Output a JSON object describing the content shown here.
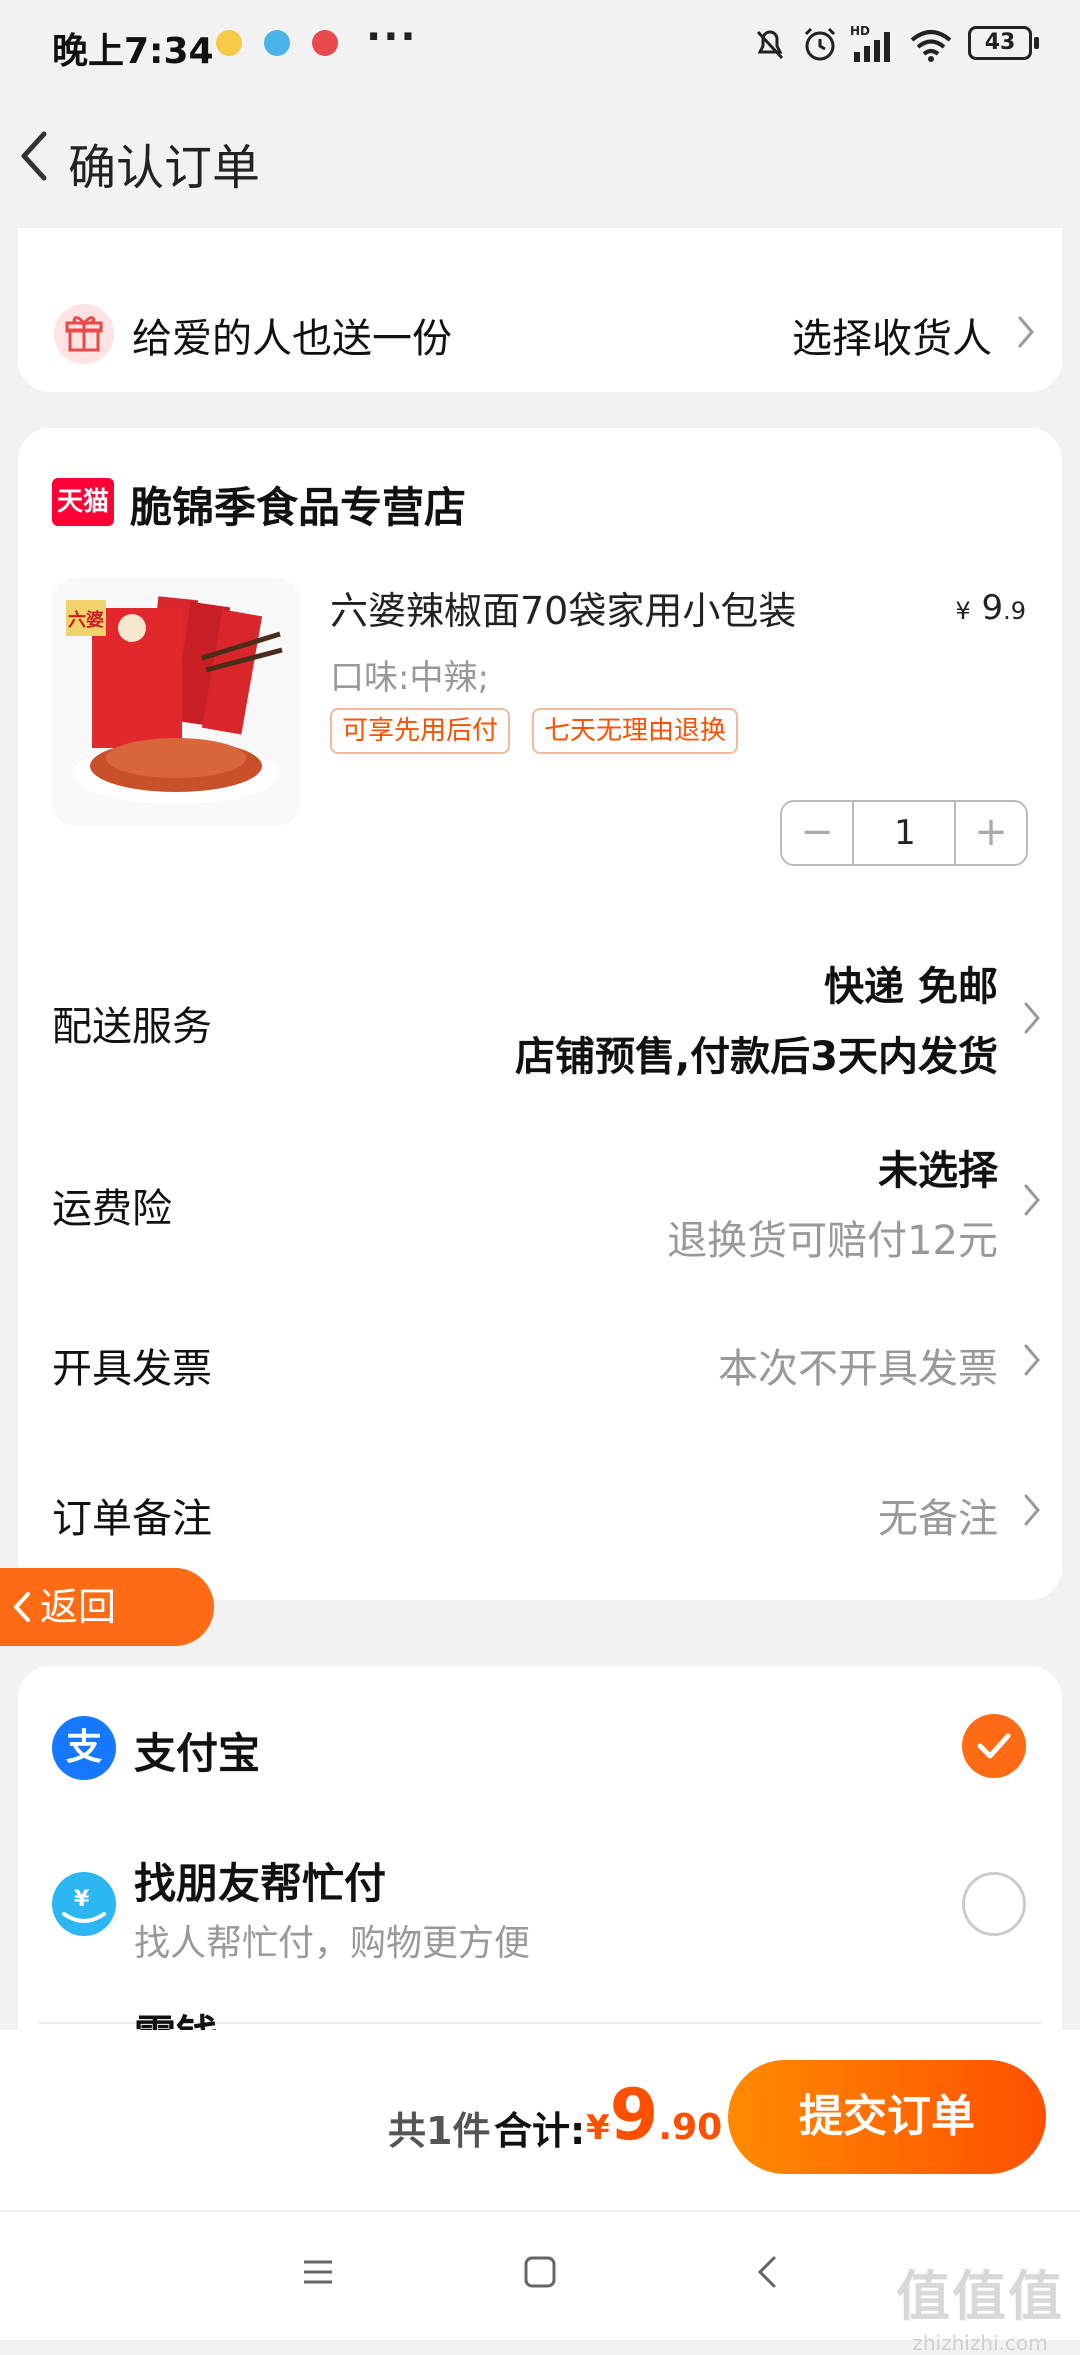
{
  "status_bar": {
    "time": "晚上7:34",
    "more": "···",
    "battery": "43",
    "network_label": "HD"
  },
  "header": {
    "title": "确认订单"
  },
  "gift": {
    "text": "给爱的人也送一份",
    "action": "选择收货人"
  },
  "store": {
    "badge": "天猫",
    "name": "脆锦季食品专营店"
  },
  "product": {
    "title": "六婆辣椒面70袋家用小包装",
    "price_symbol": "¥",
    "price_int": "9",
    "price_dec": ".9",
    "flavor": "口味:中辣;",
    "tags": [
      "可享先用后付",
      "七天无理由退换"
    ],
    "quantity": "1",
    "image_brand_text": "六婆"
  },
  "delivery": {
    "label": "配送服务",
    "line1": "快递 免邮",
    "line2": "店铺预售,付款后3天内发货"
  },
  "insurance": {
    "label": "运费险",
    "line1": "未选择",
    "line2": "退换货可赔付12元"
  },
  "invoice": {
    "label": "开具发票",
    "value": "本次不开具发票"
  },
  "note": {
    "label": "订单备注",
    "value": "无备注"
  },
  "float_back": {
    "label": "返回"
  },
  "payment": {
    "alipay_icon": "支",
    "alipay_label": "支付宝",
    "friend_label": "找朋友帮忙付",
    "friend_desc": "找人帮忙付，购物更方便",
    "friend_icon": "¥",
    "partial_label": "零钱"
  },
  "bottom": {
    "count": "共1件",
    "total_label": "合计:",
    "currency": "¥",
    "amount_int": "9",
    "amount_dec": ".90",
    "submit": "提交订单"
  },
  "watermark": {
    "big": "值值值",
    "small": "zhizhizhi.com"
  },
  "colors": {
    "accent": "#ff5000",
    "orange": "#ff6a14",
    "alipay_blue": "#1677ff",
    "tmall_red": "#ff0036"
  }
}
